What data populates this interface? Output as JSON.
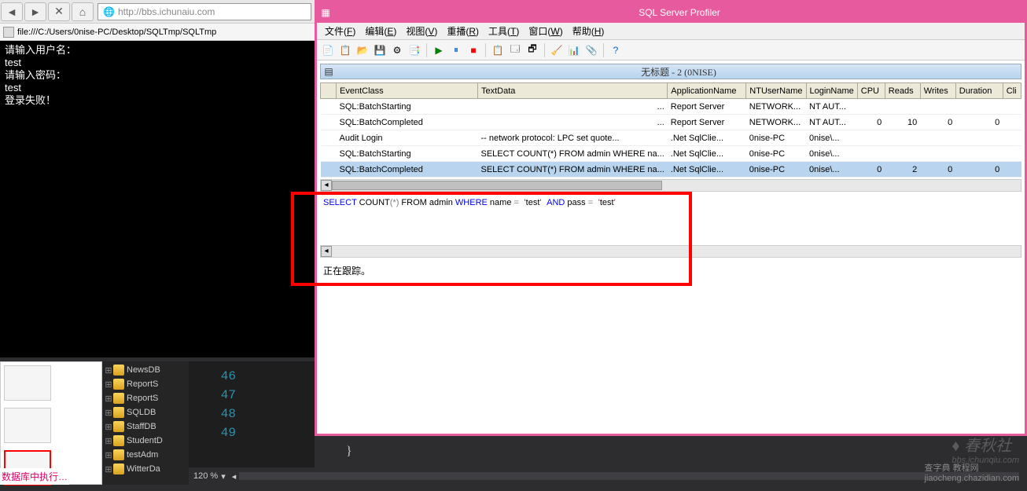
{
  "browser": {
    "url": "http://bbs.ichunaiu.com",
    "tab_title": "file:///C:/Users/0nise-PC/Desktop/SQLTmp/SQLTmp"
  },
  "console": {
    "lines": [
      "请输入用户名：",
      "test",
      "请输入密码：",
      "test",
      "登录失败！"
    ]
  },
  "tree": {
    "items": [
      "NewsDB",
      "ReportS",
      "ReportS",
      "SQLDB",
      "StaffDB",
      "StudentD",
      "testAdm",
      "WitterDa"
    ]
  },
  "gutter": {
    "lines": [
      "46",
      "47",
      "48",
      "49"
    ],
    "brace": "}"
  },
  "zoom": "120 %",
  "bottom_text": "数据库中执行…",
  "profiler": {
    "title": "SQL Server Profiler",
    "menus": [
      {
        "t": "文件",
        "k": "F"
      },
      {
        "t": "编辑",
        "k": "E"
      },
      {
        "t": "视图",
        "k": "V"
      },
      {
        "t": "重播",
        "k": "R"
      },
      {
        "t": "工具",
        "k": "T"
      },
      {
        "t": "窗口",
        "k": "W"
      },
      {
        "t": "帮助",
        "k": "H"
      }
    ],
    "trace_title": "无标题 - 2 (0NISE)",
    "columns": [
      "EventClass",
      "TextData",
      "ApplicationName",
      "NTUserName",
      "LoginName",
      "CPU",
      "Reads",
      "Writes",
      "Duration",
      "Cli"
    ],
    "rows": [
      {
        "ec": "SQL:BatchStarting",
        "td": "...",
        "app": "Report Server",
        "nt": "NETWORK...",
        "ln": "NT AUT...",
        "cpu": "",
        "rd": "",
        "wr": "",
        "du": ""
      },
      {
        "ec": "SQL:BatchCompleted",
        "td": "...",
        "app": "Report Server",
        "nt": "NETWORK...",
        "ln": "NT AUT...",
        "cpu": "0",
        "rd": "10",
        "wr": "0",
        "du": "0"
      },
      {
        "ec": "Audit Login",
        "td": "-- network protocol: LPC  set quote...",
        "app": ".Net SqlClie...",
        "nt": "0nise-PC",
        "ln": "0nise\\...",
        "cpu": "",
        "rd": "",
        "wr": "",
        "du": ""
      },
      {
        "ec": "SQL:BatchStarting",
        "td": "SELECT COUNT(*) FROM admin WHERE na...",
        "app": ".Net SqlClie...",
        "nt": "0nise-PC",
        "ln": "0nise\\...",
        "cpu": "",
        "rd": "",
        "wr": "",
        "du": ""
      },
      {
        "ec": "SQL:BatchCompleted",
        "td": "SELECT COUNT(*) FROM admin WHERE na...",
        "app": ".Net SqlClie...",
        "nt": "0nise-PC",
        "ln": "0nise\\...",
        "cpu": "0",
        "rd": "2",
        "wr": "0",
        "du": "0",
        "sel": true
      }
    ],
    "sql": {
      "select": "SELECT",
      "count": " COUNT",
      "star": "(*)",
      "from": " FROM",
      "t1": " admin ",
      "where": "WHERE",
      "t2": " name ",
      "eq": "=",
      "q": "'",
      "v1": "test",
      "and": "AND",
      "t3": " pass ",
      "v2": "test"
    },
    "status": "正在跟踪。"
  },
  "watermark": {
    "main": "♦ 春秋社",
    "sub": "bbs.ichunqiu.com",
    "credit": "查字典 教程网",
    "credit2": "jiaocheng.chazidian.com"
  }
}
